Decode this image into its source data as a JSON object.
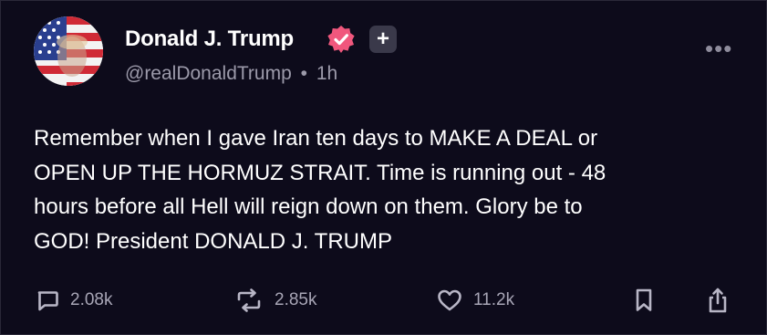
{
  "author": {
    "name": "Donald J. Trump",
    "handle": "@realDonaldTrump",
    "separator": "•",
    "time": "1h",
    "avatar_icon": "american-flag-portrait",
    "verified_icon": "verified-badge-icon",
    "verified_color": "#f0577d",
    "plus_badge": "+"
  },
  "post": {
    "lines": [
      "Remember when I gave Iran ten days to MAKE A DEAL or",
      "OPEN UP THE HORMUZ STRAIT. Time is running out - 48",
      "hours before all Hell will reign down on them. Glory be to",
      "GOD! President DONALD J. TRUMP"
    ]
  },
  "actions": {
    "replies": "2.08k",
    "reposts": "2.85k",
    "likes": "11.2k"
  },
  "menu": {
    "more_icon": "•••"
  },
  "colors": {
    "background": "#0d0b1b",
    "muted_text": "#9c9aaa"
  }
}
